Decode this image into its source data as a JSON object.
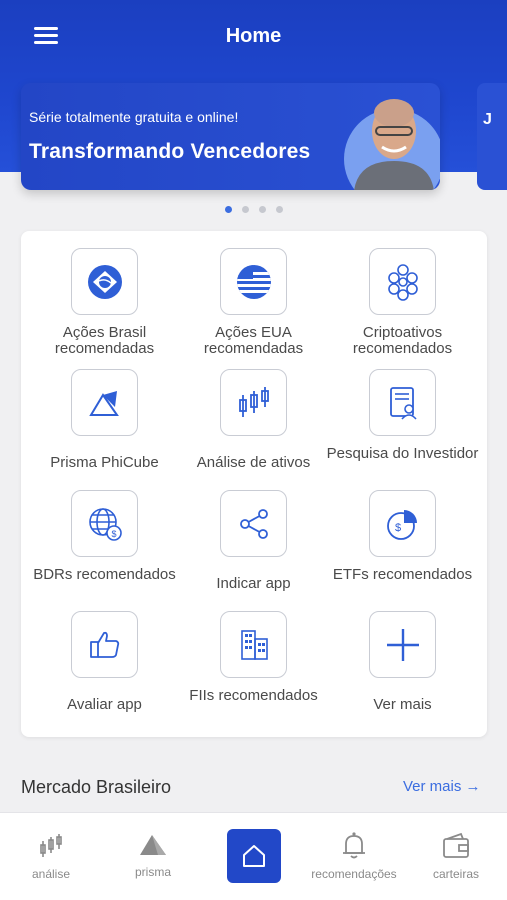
{
  "header": {
    "title": "Home"
  },
  "banner": {
    "subtitle": "Série totalmente gratuita e online!",
    "title": "Transformando Vencedores",
    "next_peek": "J"
  },
  "carousel": {
    "count": 4,
    "active": 0
  },
  "grid": [
    {
      "label": "Ações Brasil recomendadas",
      "icon": "brazil-flag-icon"
    },
    {
      "label": "Ações EUA recomendadas",
      "icon": "usa-flag-icon"
    },
    {
      "label": "Criptoativos recomendados",
      "icon": "crypto-coins-icon"
    },
    {
      "label": "Prisma PhiCube",
      "icon": "prism-icon"
    },
    {
      "label": "Análise de ativos",
      "icon": "candlestick-icon"
    },
    {
      "label": "Pesquisa do Investidor",
      "icon": "survey-icon"
    },
    {
      "label": "BDRs recomendados",
      "icon": "globe-dollar-icon"
    },
    {
      "label": "Indicar app",
      "icon": "share-icon"
    },
    {
      "label": "ETFs recomendados",
      "icon": "pie-chart-dollar-icon"
    },
    {
      "label": "Avaliar app",
      "icon": "thumbs-up-icon"
    },
    {
      "label": "FIIs recomendados",
      "icon": "buildings-icon"
    },
    {
      "label": "Ver mais",
      "icon": "plus-icon"
    }
  ],
  "market": {
    "title": "Mercado Brasileiro",
    "see_more": "Ver mais →"
  },
  "bottom_nav": [
    {
      "label": "análise",
      "icon": "candlestick-icon"
    },
    {
      "label": "prisma",
      "icon": "prism-icon"
    },
    {
      "label": "",
      "icon": "home-icon",
      "active": true
    },
    {
      "label": "recomendações",
      "icon": "bell-icon"
    },
    {
      "label": "carteiras",
      "icon": "wallet-icon"
    }
  ],
  "colors": {
    "primary": "#1f47cf",
    "accent": "#3b6de0",
    "icon_blue": "#2f5fd6"
  }
}
